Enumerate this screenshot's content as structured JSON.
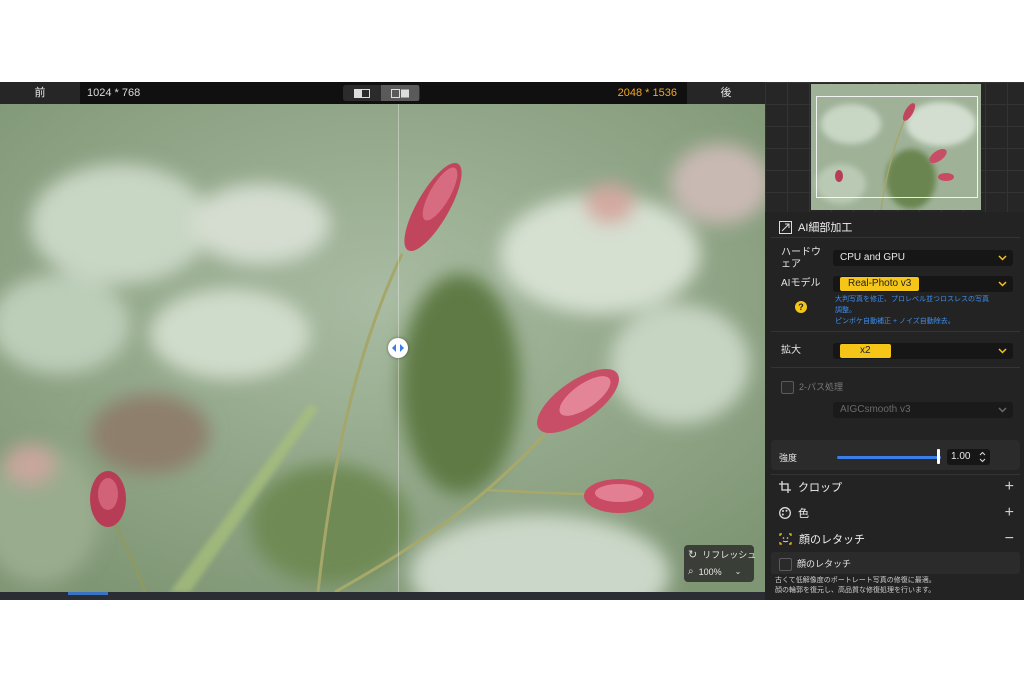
{
  "topbar": {
    "prev_label": "前",
    "next_label": "後",
    "source_resolution": "1024 * 768",
    "output_resolution": "2048 * 1536"
  },
  "viewer": {
    "refresh_label": "リフレッシュ",
    "zoom_level": "100%"
  },
  "panel": {
    "section_title": "AI細部加工",
    "hardware": {
      "label": "ハードウェア",
      "value": "CPU and GPU"
    },
    "ai_model": {
      "label": "AIモデル",
      "value": "Real-Photo  v3",
      "description_line1": "大判写真を修正、プロレベル並つロスレスの写真",
      "description_line2": "調整。",
      "description_line3": "ピンボケ自動補正 + ノイズ自動除去。"
    },
    "scale": {
      "label": "拡大",
      "value": "x2"
    },
    "two_pass": {
      "label": "2-パス処理",
      "model": "AIGCsmooth  v3"
    },
    "strength": {
      "label": "強度",
      "value": "1.00",
      "level": 1.0
    },
    "crop_label": "クロップ",
    "color_label": "色",
    "face_retouch_label": "顔のレタッチ",
    "face_retouch_option": "顔のレタッチ",
    "face_retouch_desc_line1": "古くて低解像度のポートレート写真の修復に最適。",
    "face_retouch_desc_line2": "顔の輪郭を復元し、高品質な修復処理を行います。",
    "accent_color": "#f5c518",
    "link_color": "#3d8ff2"
  }
}
